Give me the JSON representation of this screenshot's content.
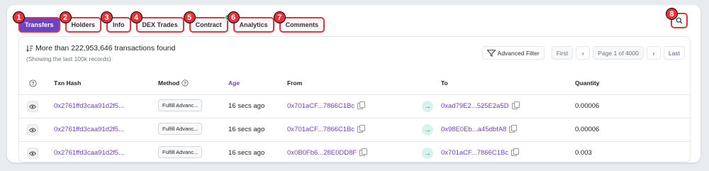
{
  "tabs": [
    {
      "label": "Transfers",
      "badge": "1"
    },
    {
      "label": "Holders",
      "badge": "2"
    },
    {
      "label": "Info",
      "badge": "3"
    },
    {
      "label": "DEX Trades",
      "badge": "4"
    },
    {
      "label": "Contract",
      "badge": "5"
    },
    {
      "label": "Analytics",
      "badge": "6"
    },
    {
      "label": "Comments",
      "badge": "7"
    }
  ],
  "search_badge": "8",
  "summary": {
    "text": "More than 222,953,646 transactions found",
    "sub": "(Showing the last 100k records)"
  },
  "controls": {
    "advanced_filter": "Advanced Filter",
    "first": "First",
    "page": "Page 1 of 4000",
    "last": "Last"
  },
  "columns": {
    "txn_hash": "Txn Hash",
    "method": "Method",
    "age": "Age",
    "from": "From",
    "to": "To",
    "quantity": "Quantity"
  },
  "rows": [
    {
      "hash": "0x2761ffd3caa91d2f5...",
      "method": "Fulfill Advanc...",
      "age": "16 secs ago",
      "from": "0x701aCF...7866C1Bc",
      "to": "0xad79E2...525E2a5D",
      "quantity": "0.00006"
    },
    {
      "hash": "0x2761ffd3caa91d2f5...",
      "method": "Fulfill Advanc...",
      "age": "16 secs ago",
      "from": "0x701aCF...7866C1Bc",
      "to": "0x98E0Eb...a45dbfA8",
      "quantity": "0.00006"
    },
    {
      "hash": "0x2761ffd3caa91d2f5...",
      "method": "Fulfill Advanc...",
      "age": "16 secs ago",
      "from": "0x0B0Fb6...28E0DD8F",
      "to": "0x701aCF...7866C1Bc",
      "quantity": "0.003"
    }
  ],
  "colors": {
    "accent": "#6f42c1",
    "annotation": "#e6333a",
    "direction": "#14a085"
  }
}
